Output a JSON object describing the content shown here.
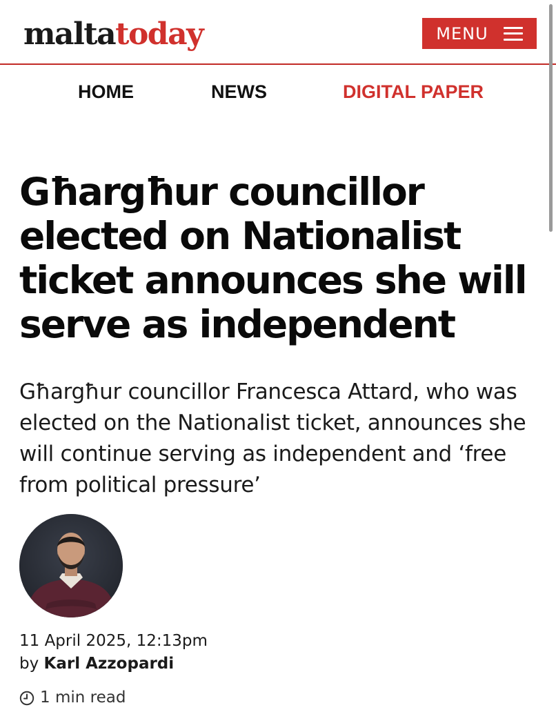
{
  "header": {
    "logo_part1": "malta",
    "logo_part2": "today",
    "menu_label": "MENU"
  },
  "nav": {
    "items": [
      {
        "label": "HOME"
      },
      {
        "label": "NEWS"
      },
      {
        "label": "DIGITAL PAPER"
      }
    ]
  },
  "article": {
    "headline": "Għargħur councillor elected on Nationalist ticket announces she will serve as independent",
    "standfirst": "Għargħur councillor Francesca Attard, who was elected on the Nationalist ticket, announces she will continue serving as independent and ‘free from political pressure’",
    "date": "11 April 2025, 12:13pm",
    "byline_prefix": "by ",
    "author": "Karl Azzopardi",
    "read_time": "1 min read"
  },
  "icons": {
    "menu": "hamburger-icon",
    "read_time": "clock-icon"
  },
  "colors": {
    "brand_red": "#d0312d",
    "text": "#111111"
  }
}
